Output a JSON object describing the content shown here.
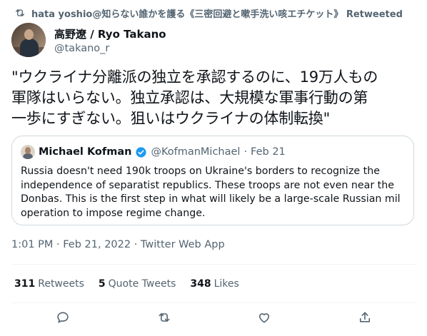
{
  "retweet_banner": {
    "icon": "retweet-icon",
    "text": "hata yoshio@知らない誰かを護る《三密回避と嗽手洗い咳エチケット》 Retweeted"
  },
  "author": {
    "name": "高野遼 / Ryo Takano",
    "handle": "@takano_r",
    "avatar": "avatar-photo"
  },
  "tweet": {
    "lines": [
      "\"ウクライナ分離派の独立を承認するのに、19万人もの",
      "軍隊はいらない。独立承認は、大規模な軍事行動の第",
      "一歩にすぎない。狙いはウクライナの体制転換\""
    ]
  },
  "quote": {
    "name": "Michael Kofman",
    "verified_icon": "verified-badge-icon",
    "handle": "@KofmanMichael",
    "separator": "·",
    "date": "Feb 21",
    "lines": [
      "Russia doesn't need 190k troops on Ukraine's borders to recognize the",
      "independence of separatist republics. These troops are not even near the",
      "Donbas. This is the first step in what will likely be a large-scale Russian mil",
      "operation to impose regime change."
    ]
  },
  "timestamp": "1:01 PM · Feb 21, 2022 · Twitter Web App",
  "stats": {
    "retweets_count": "311",
    "retweets_label": "Retweets",
    "quotes_count": "5",
    "quotes_label": "Quote Tweets",
    "likes_count": "348",
    "likes_label": "Likes"
  },
  "actions": [
    "reply-icon",
    "retweet-icon",
    "like-icon",
    "share-icon"
  ],
  "colors": {
    "text_primary": "#0f1419",
    "text_secondary": "#536471",
    "border": "#cfd9de",
    "divider": "#eff3f4",
    "verified": "#1d9bf0"
  }
}
